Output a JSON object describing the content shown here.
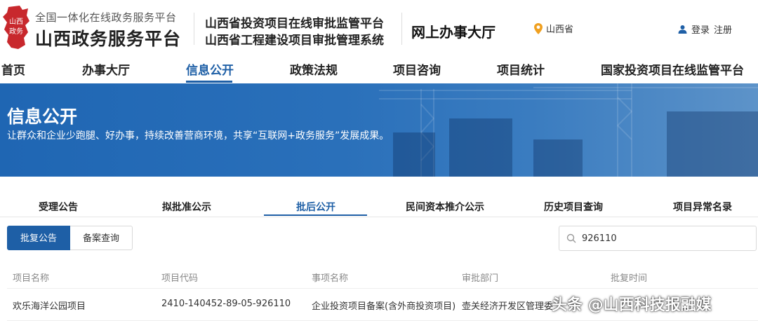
{
  "header": {
    "logo_seal_text": "山西政务",
    "logo_top": "全国一体化在线政务服务平台",
    "logo_main": "山西政务服务平台",
    "system_line1": "山西省投资项目在线审批监管平台",
    "system_line2": "山西省工程建设项目审批管理系统",
    "hall_title": "网上办事大厅",
    "location": "山西省",
    "login": "登录",
    "register": "注册",
    "location_icon": "map-pin-icon",
    "user_icon": "user-icon"
  },
  "nav": {
    "items": [
      "首页",
      "办事大厅",
      "信息公开",
      "政策法规",
      "项目咨询",
      "项目统计",
      "国家投资项目在线监管平台"
    ],
    "active": "信息公开"
  },
  "banner": {
    "title": "信息公开",
    "subtitle": "让群众和企业少跑腿、好办事，持续改善营商环境，共享“互联网+政务服务”发展成果。"
  },
  "subtabs": {
    "items": [
      "受理公告",
      "拟批准公示",
      "批后公开",
      "民间资本推介公示",
      "历史项目查询",
      "项目异常名录"
    ],
    "active": "批后公开"
  },
  "toggle": {
    "items": [
      "批复公告",
      "备案查询"
    ],
    "active": "批复公告"
  },
  "search": {
    "value": "926110",
    "icon": "search-icon"
  },
  "table": {
    "columns": [
      "项目名称",
      "项目代码",
      "事项名称",
      "审批部门",
      "批复时间"
    ],
    "rows": [
      [
        "欢乐海洋公园项目",
        "2410-140452-89-05-926110",
        "企业投资项目备案(含外商投资项目)",
        "壶关经济开发区管理委",
        ""
      ]
    ]
  },
  "watermark": "头条 @山西科技报融媒",
  "colors": {
    "primary": "#1e5fa6",
    "banner": "#2a70ba",
    "logo_red": "#c8282d",
    "location_orange": "#f0a020"
  }
}
